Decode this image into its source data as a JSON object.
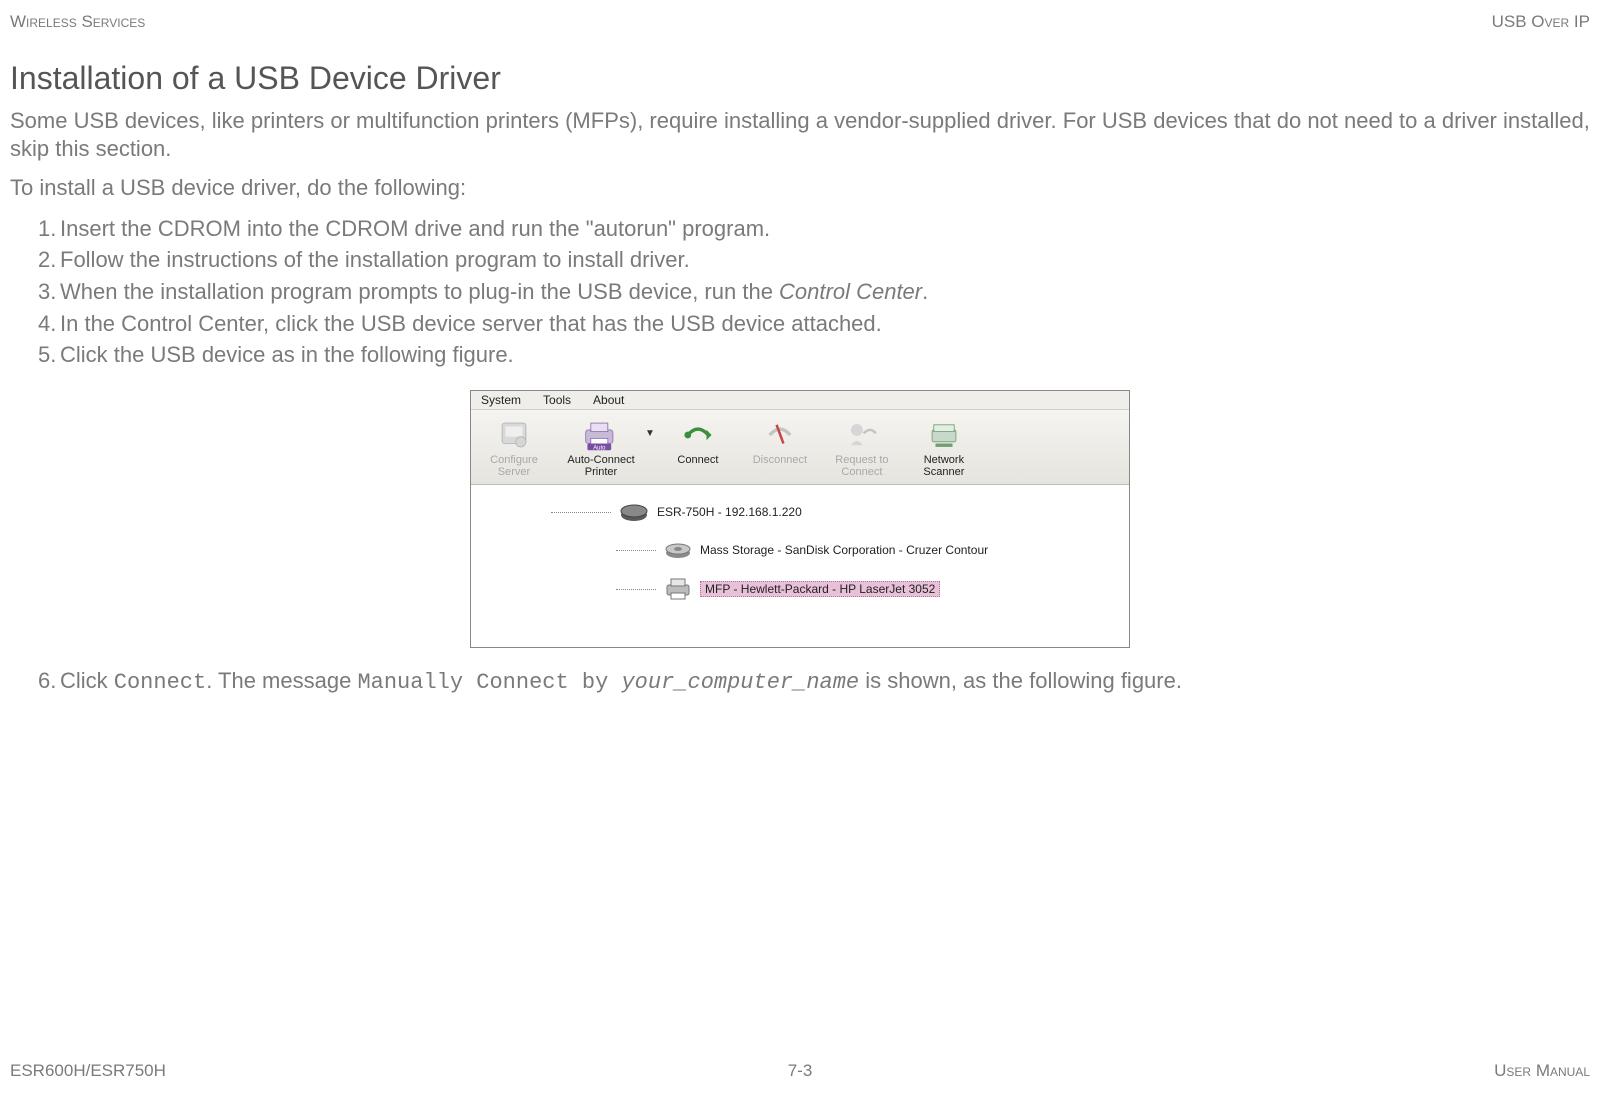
{
  "header": {
    "left": "Wireless Services",
    "right": "USB Over IP"
  },
  "title": "Installation of a USB Device Driver",
  "intro": "Some USB devices, like printers or multifunction printers (MFPs), require installing a vendor-supplied driver. For USB devices that do not need to a driver installed, skip this section.",
  "lead": "To install a USB device driver, do the following:",
  "steps": {
    "s1": "Insert the CDROM into the CDROM drive and run the \"autorun\" program.",
    "s2": "Follow the instructions of the installation program to install driver.",
    "s3_a": "When the installation program prompts to plug-in the USB device, run the ",
    "s3_b": "Control Center",
    "s3_c": ".",
    "s4": "In the Control Center, click the USB device server that has the USB device attached.",
    "s5": "Click the USB device as in the following figure.",
    "s6_a": "Click ",
    "s6_b": "Connect",
    "s6_c": ". The message ",
    "s6_d": "Manually Connect by ",
    "s6_e": "your_computer_name",
    "s6_f": " is shown, as the following figure."
  },
  "menubar": {
    "system": "System",
    "tools": "Tools",
    "about": "About"
  },
  "toolbar": {
    "configure": {
      "line1": "Configure",
      "line2": "Server"
    },
    "autoconnect": {
      "line1": "Auto-Connect",
      "line2": "Printer"
    },
    "connect": "Connect",
    "disconnect": "Disconnect",
    "request": {
      "line1": "Request to",
      "line2": "Connect"
    },
    "scanner": {
      "line1": "Network",
      "line2": "Scanner"
    }
  },
  "tree": {
    "server": "ESR-750H - 192.168.1.220",
    "storage": "Mass Storage - SanDisk Corporation - Cruzer Contour",
    "mfp": "MFP - Hewlett-Packard - HP LaserJet 3052"
  },
  "footer": {
    "left": "ESR600H/ESR750H",
    "center": "7-3",
    "right": "User Manual"
  }
}
